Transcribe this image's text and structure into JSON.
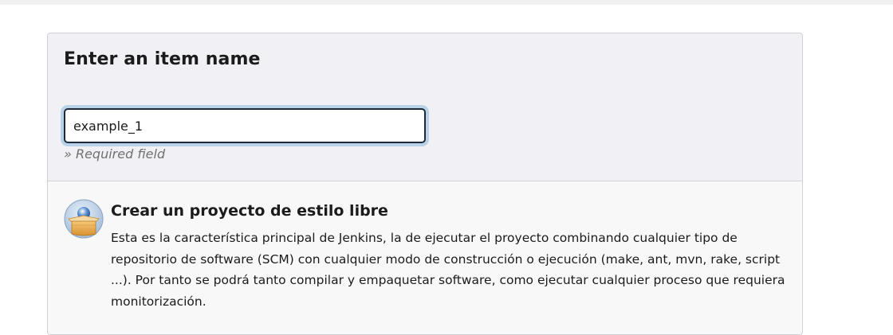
{
  "form": {
    "title": "Enter an item name",
    "name_input": {
      "value": "example_1",
      "placeholder": ""
    },
    "required_note": "» Required field"
  },
  "item_types": [
    {
      "icon": "freestyle-project-icon",
      "label": "Crear un proyecto de estilo libre",
      "description": "Esta es la característica principal de Jenkins, la de ejecutar el proyecto combinando cualquier tipo de repositorio de software (SCM) con cualquier modo de construcción o ejecución (make, ant, mvn, rake, script ...). Por tanto se podrá tanto compilar y empaquetar software, como ejecutar cualquier proceso que requiera monitorización."
    }
  ]
}
